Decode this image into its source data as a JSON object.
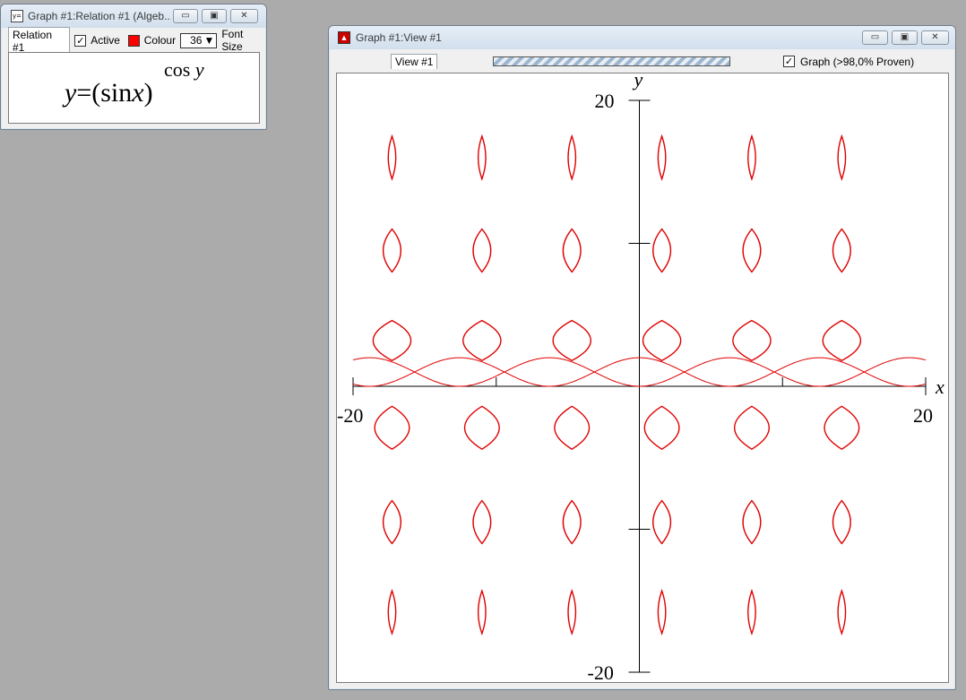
{
  "relation_window": {
    "title": "Graph #1:Relation #1 (Algeb...",
    "icon": "y=-icon",
    "tab_label": "Relation #1",
    "active_label": "Active",
    "active_checked": true,
    "colour_label": "Colour",
    "colour": "#ff0000",
    "font_size_value": "36",
    "font_size_label": "Font Size",
    "equation": {
      "lhs": "y",
      "equals": "=",
      "open": "(",
      "func": "sin",
      "arg": "x",
      "close": ")",
      "exp_func": "cos",
      "exp_arg": "y"
    }
  },
  "view_window": {
    "title": "Graph #1:View #1",
    "icon": "graph-icon",
    "tab_label": "View #1",
    "graph_checkbox_label": "Graph (>98,0% Proven)",
    "graph_checked": true,
    "progress_fraction": 0.98,
    "accent_color": "#e00000"
  },
  "window_buttons": {
    "minimize": "▭",
    "maximize": "▣",
    "close": "✕"
  },
  "chart_data": {
    "type": "line",
    "relation": "y=(sinx)^cosy",
    "xlabel": "x",
    "ylabel": "y",
    "xlim": [
      -20,
      20
    ],
    "ylim": [
      -20,
      20
    ],
    "x_tick_labels": [
      "-20",
      "20"
    ],
    "y_tick_labels": [
      "20",
      "-20"
    ],
    "curve_color": "#e00000",
    "grid": false
  }
}
